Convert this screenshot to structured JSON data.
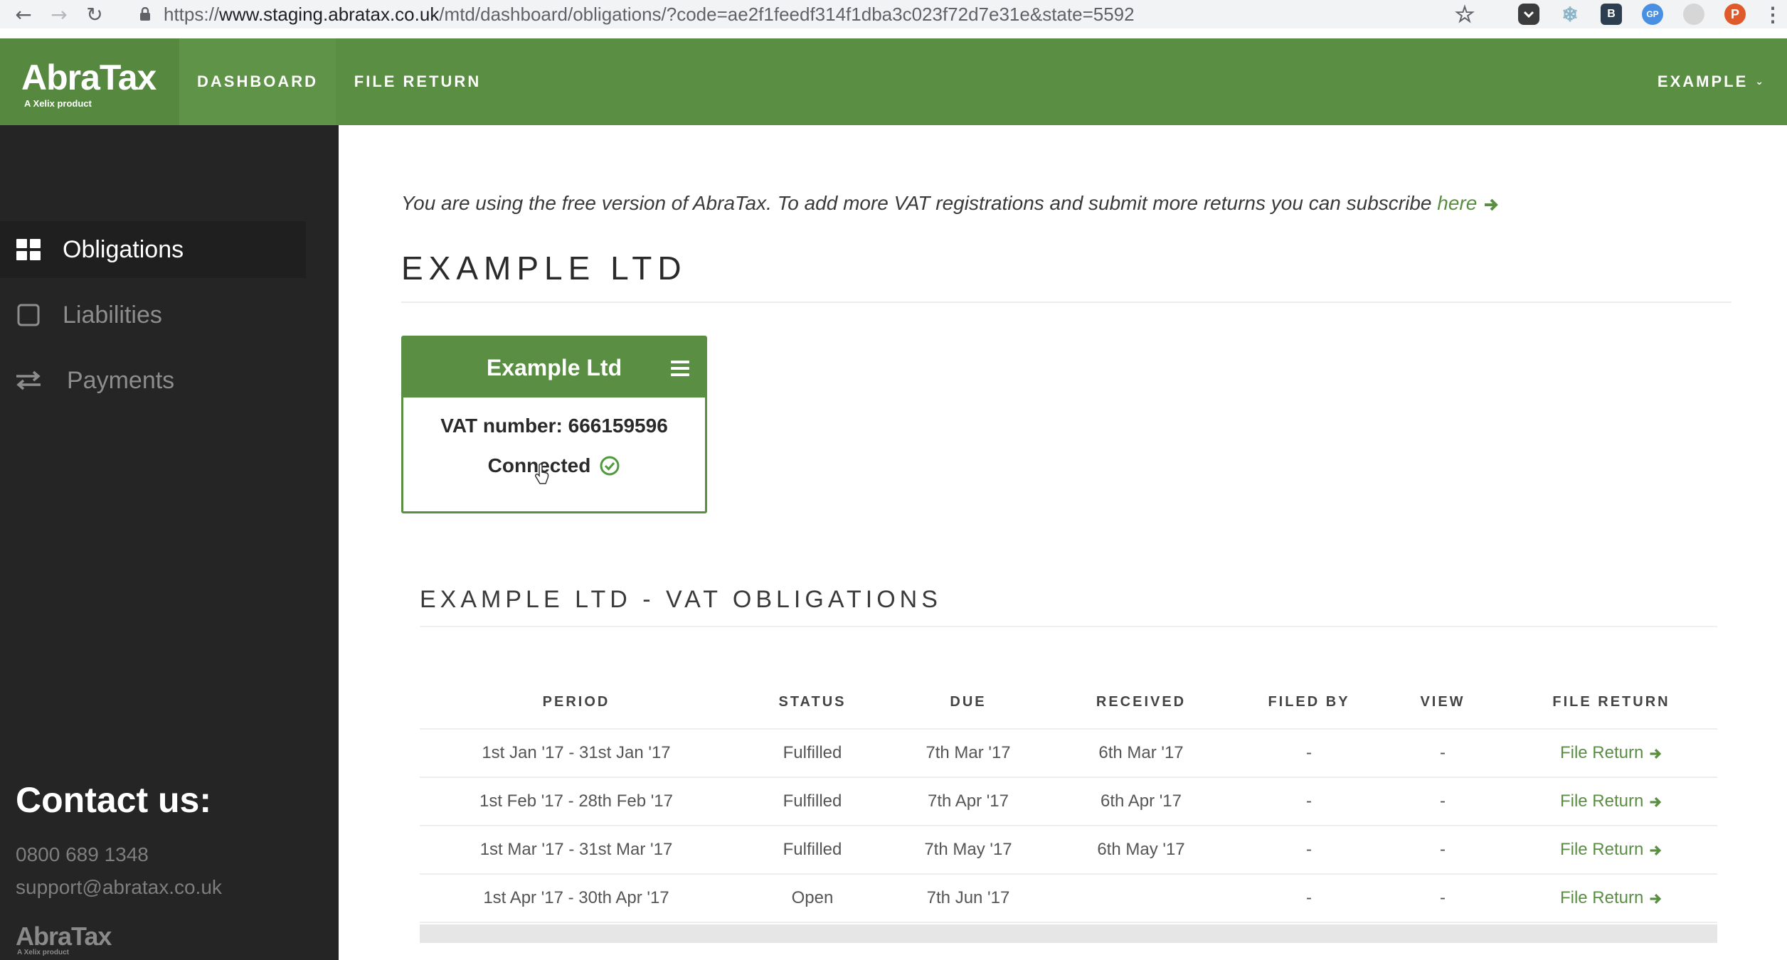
{
  "browser": {
    "url_prefix": "https://",
    "url_host": "www.staging.abratax.co.uk",
    "url_path": "/mtd/dashboard/obligations/?code=ae2f1feedf314f1dba3c023f72d7e31e&state=5592",
    "avatar_letter": "P",
    "ext_b_letter": "B",
    "ext_gp_letter": "GP"
  },
  "header": {
    "logo": "AbraTax",
    "logo_sub": "A Xelix product",
    "nav": [
      {
        "label": "DASHBOARD"
      },
      {
        "label": "FILE RETURN"
      }
    ],
    "account_label": "EXAMPLE",
    "accent": "#5a8e43"
  },
  "sidebar": {
    "items": [
      {
        "label": "Obligations",
        "icon": "grid-icon",
        "active": true
      },
      {
        "label": "Liabilities",
        "icon": "square-icon",
        "active": false
      },
      {
        "label": "Payments",
        "icon": "transfer-arrows-icon",
        "active": false
      }
    ],
    "contact_title": "Contact us:",
    "phone": "0800 689 1348",
    "email": "support@abratax.co.uk",
    "footer_logo": "AbraTax",
    "footer_logo_sub": "A Xelix product"
  },
  "main": {
    "notice": "You are using the free version of AbraTax. To add more VAT registrations and submit more returns you can subscribe",
    "notice_link": "here",
    "company_title": "EXAMPLE LTD",
    "card": {
      "name": "Example Ltd",
      "vat_number": "VAT number: 666159596",
      "status": "Connected"
    },
    "obligations_title": "EXAMPLE LTD - VAT OBLIGATIONS",
    "table": {
      "headers": [
        "PERIOD",
        "STATUS",
        "DUE",
        "RECEIVED",
        "FILED BY",
        "VIEW",
        "FILE RETURN"
      ],
      "rows": [
        {
          "period": "1st Jan '17 - 31st Jan '17",
          "status": "Fulfilled",
          "due": "7th Mar '17",
          "received": "6th Mar '17",
          "filed_by": "-",
          "view": "-",
          "action": "File Return"
        },
        {
          "period": "1st Feb '17 - 28th Feb '17",
          "status": "Fulfilled",
          "due": "7th Apr '17",
          "received": "6th Apr '17",
          "filed_by": "-",
          "view": "-",
          "action": "File Return"
        },
        {
          "period": "1st Mar '17 - 31st Mar '17",
          "status": "Fulfilled",
          "due": "7th May '17",
          "received": "6th May '17",
          "filed_by": "-",
          "view": "-",
          "action": "File Return"
        },
        {
          "period": "1st Apr '17 - 30th Apr '17",
          "status": "Open",
          "due": "7th Jun '17",
          "received": "",
          "filed_by": "-",
          "view": "-",
          "action": "File Return"
        }
      ]
    }
  }
}
